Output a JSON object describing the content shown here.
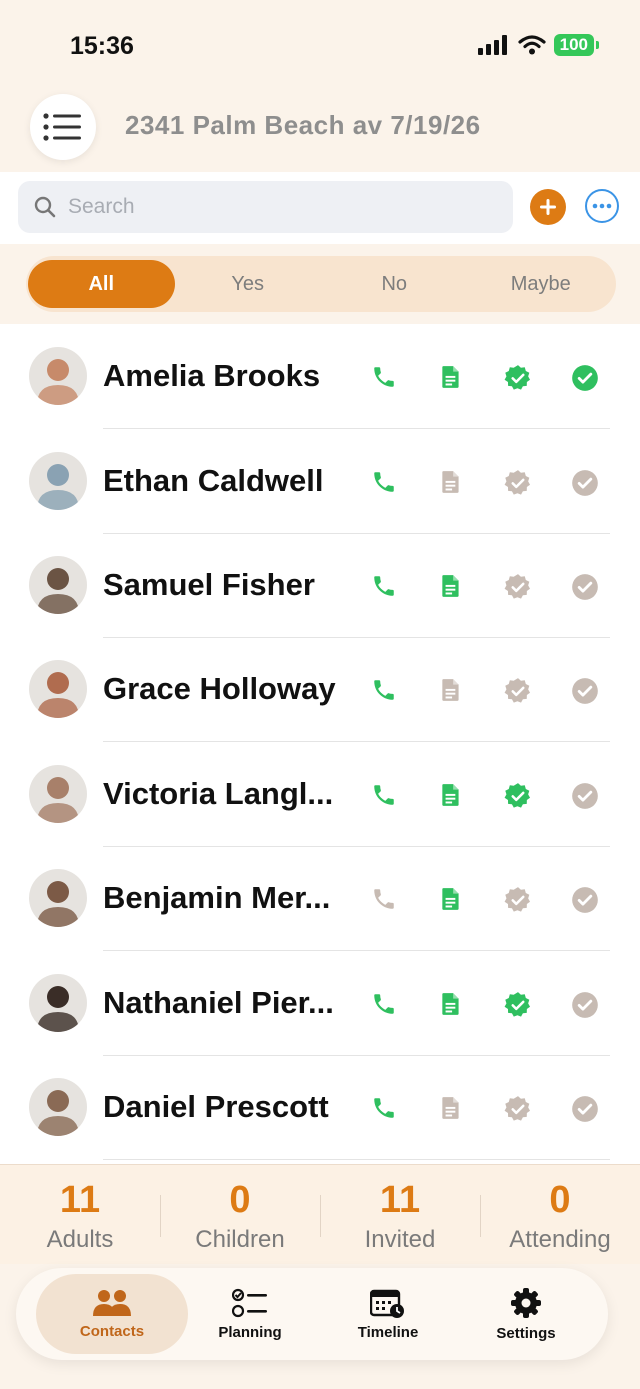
{
  "status_bar": {
    "time": "15:36",
    "battery": "100"
  },
  "header": {
    "title": "2341 Palm Beach av 7/19/26"
  },
  "search": {
    "placeholder": "Search"
  },
  "filters": {
    "all": "All",
    "yes": "Yes",
    "no": "No",
    "maybe": "Maybe",
    "selected": "All"
  },
  "contacts": [
    {
      "name": "Amelia Brooks",
      "phone": true,
      "document": true,
      "badge": true,
      "check": true,
      "avatar_color": "#c78a6a"
    },
    {
      "name": "Ethan Caldwell",
      "phone": true,
      "document": false,
      "badge": false,
      "check": false,
      "avatar_color": "#8aa2b3"
    },
    {
      "name": "Samuel Fisher",
      "phone": true,
      "document": true,
      "badge": false,
      "check": false,
      "avatar_color": "#6b5444"
    },
    {
      "name": "Grace Holloway",
      "phone": true,
      "document": false,
      "badge": false,
      "check": false,
      "avatar_color": "#b06c4f"
    },
    {
      "name": "Victoria Langl...",
      "phone": true,
      "document": true,
      "badge": true,
      "check": false,
      "avatar_color": "#a8806a"
    },
    {
      "name": "Benjamin Mer...",
      "phone": false,
      "document": true,
      "badge": false,
      "check": false,
      "avatar_color": "#7c5a46"
    },
    {
      "name": "Nathaniel Pier...",
      "phone": true,
      "document": true,
      "badge": true,
      "check": false,
      "avatar_color": "#3a2d27"
    },
    {
      "name": "Daniel Prescott",
      "phone": true,
      "document": false,
      "badge": false,
      "check": false,
      "avatar_color": "#8a6a55"
    }
  ],
  "stats": {
    "adults": {
      "value": "11",
      "label": "Adults"
    },
    "children": {
      "value": "0",
      "label": "Children"
    },
    "invited": {
      "value": "11",
      "label": "Invited"
    },
    "attending": {
      "value": "0",
      "label": "Attending"
    }
  },
  "tabs": {
    "contacts": "Contacts",
    "planning": "Planning",
    "timeline": "Timeline",
    "settings": "Settings",
    "active": "Contacts"
  },
  "colors": {
    "accent": "#dd7b14",
    "green": "#2fbf5f",
    "gray_icon": "#c7bbb3",
    "link_blue": "#3b94e6"
  }
}
